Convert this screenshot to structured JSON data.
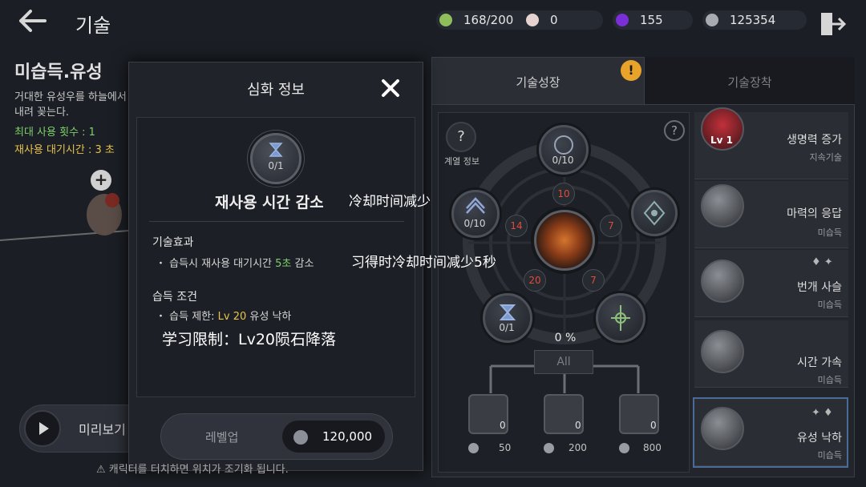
{
  "header": {
    "title": "기술",
    "currencies": [
      {
        "icon": "green-gem-icon",
        "value": "168/200",
        "color": "#8fbf5a"
      },
      {
        "icon": "pearl-icon",
        "value": "0",
        "color": "#e6d3cf"
      },
      {
        "icon": "purple-orb-icon",
        "value": "155",
        "color": "#7a2fd8"
      },
      {
        "icon": "silver-coin-icon",
        "value": "125354",
        "color": "#a9abb3"
      }
    ]
  },
  "background_panel": {
    "skill_name": "미습득.유성",
    "description": "거대한 유성우를 하늘에서 내려 꽂는다.",
    "max_uses": "최대 사용 횟수 : 1",
    "cooldown": "재사용 대기시간 : 3 초",
    "preview_label": "미리보기",
    "warning": "캐릭터를 터치하면 위치가 조기화 됩니다."
  },
  "popup": {
    "title": "심화 정보",
    "badge_count": "0/1",
    "skill_name": "재사용 시간 감소",
    "annotation_1": "冷却时间减少",
    "effect_heading": "기술효과",
    "effect_prefix": "습득시 재사용 대기시간 ",
    "effect_value": "5초",
    "effect_suffix": " 감소",
    "annotation_2": "习得时冷却时间减少5秒",
    "condition_heading": "습득 조건",
    "condition_prefix": "습득 제한: ",
    "condition_level": "Lv 20",
    "condition_suffix": " 유성 낙하",
    "annotation_3": "学习限制：Lv20陨石降落",
    "levelup_label": "레벨업",
    "price": "120,000"
  },
  "tabs": {
    "growth": "기술성장",
    "equip": "기술장착",
    "alert": "!"
  },
  "tree": {
    "series_info_label": "계열 정보",
    "series_info_glyph": "?",
    "help_glyph": "?",
    "nodes": {
      "top_count": "0/10",
      "left_count": "0/10",
      "bottom_left_count": "0/1"
    },
    "pips": [
      "10",
      "14",
      "7",
      "20",
      "7"
    ],
    "progress": "0 %",
    "all_label": "All",
    "books": [
      {
        "count": "0",
        "cost": "50"
      },
      {
        "count": "0",
        "cost": "200"
      },
      {
        "count": "0",
        "cost": "800"
      }
    ]
  },
  "skills": [
    {
      "name": "생명력 증가",
      "sub": "지속기술",
      "lv": "Lv 1"
    },
    {
      "name": "마력의 응답",
      "sub": "미습득"
    },
    {
      "name": "번개 사슬",
      "sub": "미습득"
    },
    {
      "name": "시간 가속",
      "sub": "미습득"
    },
    {
      "name": "유성 낙하",
      "sub": "미습득"
    }
  ]
}
